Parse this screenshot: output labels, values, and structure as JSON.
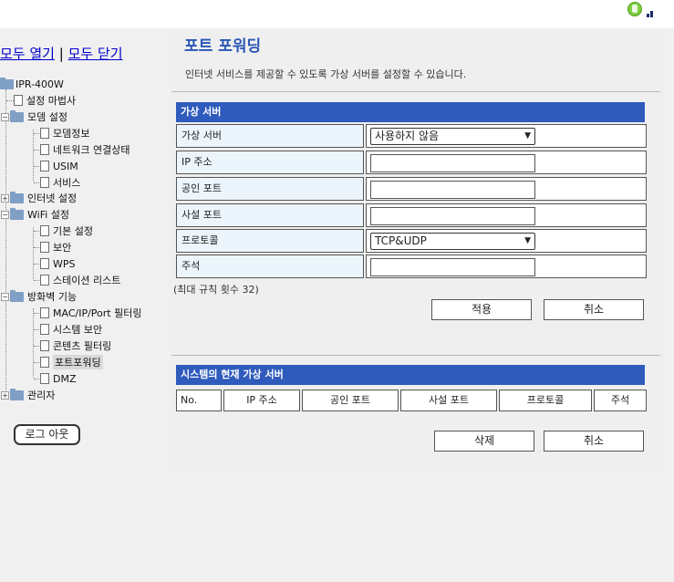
{
  "topbar": {
    "globe_icon": "globe-icon",
    "signal_icon": "signal-bars-icon"
  },
  "sidebar": {
    "expand_all": "모두 열기",
    "separator": "|",
    "collapse_all": "모두 닫기",
    "root": "IPR-400W",
    "items": [
      {
        "label": "설정 마법사"
      },
      {
        "label": "모뎀 설정"
      },
      {
        "label": "모뎀정보"
      },
      {
        "label": "네트워크 연결상태"
      },
      {
        "label": "USIM"
      },
      {
        "label": "서비스"
      },
      {
        "label": "인터넷 설정"
      },
      {
        "label": "WiFi 설정"
      },
      {
        "label": "기본 설정"
      },
      {
        "label": "보안"
      },
      {
        "label": "WPS"
      },
      {
        "label": "스테이션 리스트"
      },
      {
        "label": "방화벽 기능"
      },
      {
        "label": "MAC/IP/Port 필터링"
      },
      {
        "label": "시스템 보안"
      },
      {
        "label": "콘텐츠 필터링"
      },
      {
        "label": "포트포워딩"
      },
      {
        "label": "DMZ"
      },
      {
        "label": "관리자"
      }
    ],
    "logout": "로그 아웃"
  },
  "main": {
    "title": "포트 포워딩",
    "description": "인터넷 서비스를 제공할 수 있도록 가상 서버를 설정할 수 있습니다.",
    "virtual_server": {
      "header": "가상 서버",
      "fields": {
        "enable_label": "가상 서버",
        "enable_value": "사용하지 않음",
        "ip_label": "IP 주소",
        "ip_value": "",
        "public_port_label": "공인 포트",
        "public_port_value": "",
        "private_port_label": "사설 포트",
        "private_port_value": "",
        "protocol_label": "프로토콜",
        "protocol_value": "TCP&UDP",
        "comment_label": "주석",
        "comment_value": ""
      },
      "note": "(최대 규칙 횟수 32)",
      "apply": "적용",
      "cancel": "취소"
    },
    "current": {
      "header": "시스템의 현재 가상 서버",
      "columns": [
        "No.",
        "IP 주소",
        "공인 포트",
        "사설 포트",
        "프로토콜",
        "주석"
      ],
      "delete": "삭제",
      "cancel": "취소"
    }
  }
}
